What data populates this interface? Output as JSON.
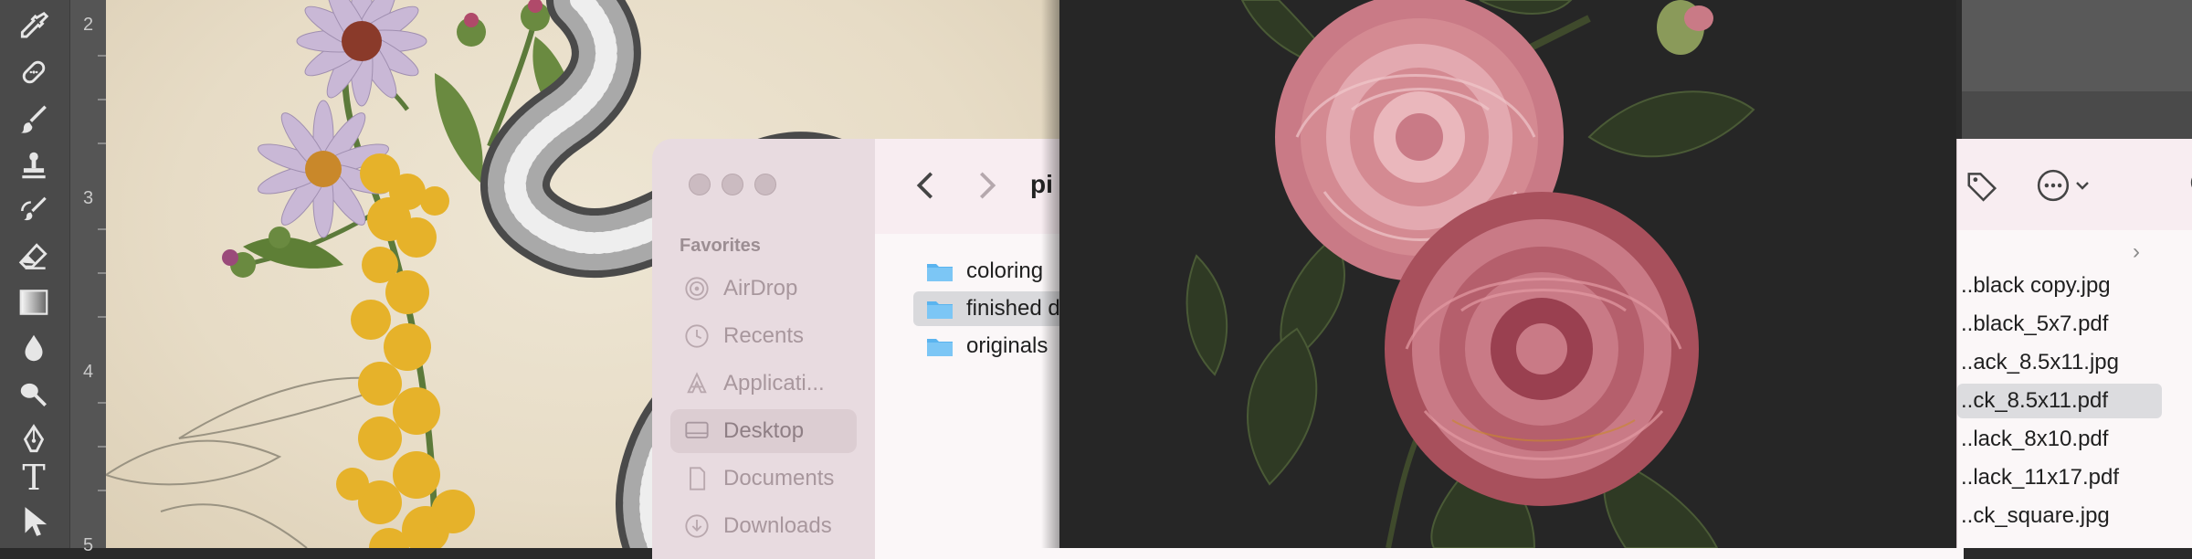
{
  "photoshop": {
    "tools": [
      {
        "icon": "eyedropper-icon"
      },
      {
        "icon": "healing-brush-icon"
      },
      {
        "icon": "brush-icon"
      },
      {
        "icon": "clone-stamp-icon"
      },
      {
        "icon": "history-brush-icon"
      },
      {
        "icon": "eraser-icon"
      },
      {
        "icon": "gradient-icon"
      },
      {
        "icon": "blur-icon"
      },
      {
        "icon": "dodge-icon"
      },
      {
        "icon": "pen-icon"
      },
      {
        "icon": "type-icon"
      },
      {
        "icon": "path-selection-icon"
      }
    ],
    "type_tool_glyph": "T",
    "ruler_numbers": [
      "2",
      "3",
      "4",
      "5"
    ]
  },
  "finder": {
    "traffic_lights": [
      "close",
      "minimize",
      "zoom"
    ],
    "toolbar": {
      "back_icon": "chevron-left-icon",
      "forward_icon": "chevron-right-icon",
      "title_partial": "pi"
    },
    "sidebar": {
      "section": "Favorites",
      "items": [
        {
          "label": "AirDrop",
          "icon": "airdrop-icon",
          "selected": false
        },
        {
          "label": "Recents",
          "icon": "clock-icon",
          "selected": false
        },
        {
          "label": "Applicati...",
          "icon": "applications-icon",
          "selected": false
        },
        {
          "label": "Desktop",
          "icon": "desktop-icon",
          "selected": true
        },
        {
          "label": "Documents",
          "icon": "document-icon",
          "selected": false
        },
        {
          "label": "Downloads",
          "icon": "download-icon",
          "selected": false
        }
      ]
    },
    "files": [
      {
        "name": "coloring",
        "selected": false
      },
      {
        "name": "finished d",
        "selected": true
      },
      {
        "name": "originals",
        "selected": false
      }
    ]
  },
  "right_finder": {
    "toolbar": {
      "tag_icon": "tag-icon",
      "more_icon": "more-options-icon",
      "chevron_icon": "chevron-down-icon"
    },
    "path_chevron": "›",
    "files": [
      {
        "name": "..black copy.jpg",
        "selected": false
      },
      {
        "name": "..black_5x7.pdf",
        "selected": false
      },
      {
        "name": "..ack_8.5x11.jpg",
        "selected": false
      },
      {
        "name": "..ck_8.5x11.pdf",
        "selected": true
      },
      {
        "name": "..lack_8x10.pdf",
        "selected": false
      },
      {
        "name": "..lack_11x17.pdf",
        "selected": false
      },
      {
        "name": "..ck_square.jpg",
        "selected": false
      }
    ]
  },
  "colors": {
    "finder_folder": "#5ab4ef",
    "canvas_paper": "#e7dcc6",
    "preview_bg": "#262626",
    "rose_pink": "#d48a92"
  }
}
